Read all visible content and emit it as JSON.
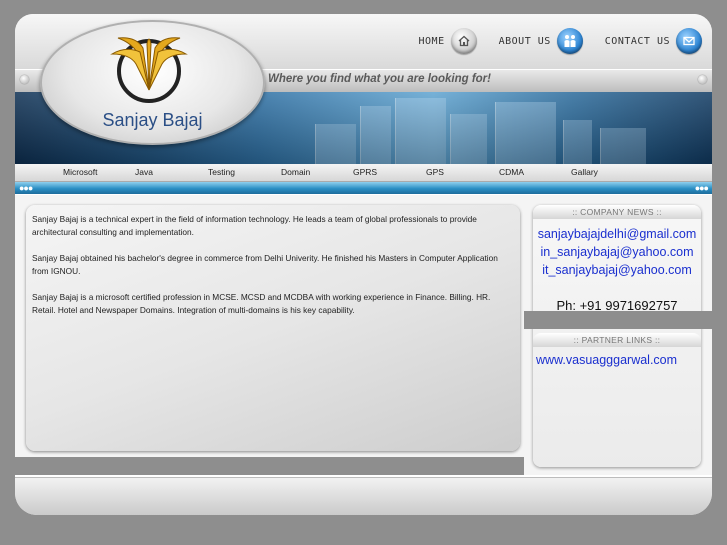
{
  "site": {
    "name": "Sanjay Bajaj",
    "tagline": "Where you find what you are looking for!"
  },
  "topnav": [
    {
      "label": "HOME",
      "icon": "home-icon"
    },
    {
      "label": "ABOUT US",
      "icon": "people-icon"
    },
    {
      "label": "CONTACT US",
      "icon": "mail-icon"
    }
  ],
  "menu": [
    "Microsoft",
    "Java",
    "Testing",
    "Domain",
    "GPRS",
    "GPS",
    "CDMA",
    "Gallary"
  ],
  "content": {
    "paragraphs": [
      "Sanjay Bajaj is a technical expert in the field of information technology. He leads a team of global professionals to provide architectural consulting and implementation.",
      "Sanjay Bajaj obtained his bachelor's degree in commerce from Delhi Univerity. He finished his Masters in Computer Application from IGNOU.",
      "Sanjay Bajaj is a microsoft certified profession in MCSE. MCSD and MCDBA with working experience in Finance. Billing. HR. Retail. Hotel and Newspaper Domains. Integration of multi-domains is his key capability."
    ]
  },
  "sidebar": {
    "company_news_title": ":: COMPANY NEWS ::",
    "emails": [
      "sanjaybajajdelhi@gmail.com",
      "in_sanjaybajaj@yahoo.com",
      "it_sanjaybajaj@yahoo.com"
    ],
    "phone": "Ph: +91 9971692757",
    "partner_links_title": ":: PARTNER LINKS ::",
    "partner_link": "www.vasuagggarwal.com"
  },
  "colors": {
    "accent_blue": "#2a8fc4",
    "link_blue": "#1a2fcf",
    "logo_text": "#2b4f86",
    "logo_gold": "#e4a81d"
  }
}
